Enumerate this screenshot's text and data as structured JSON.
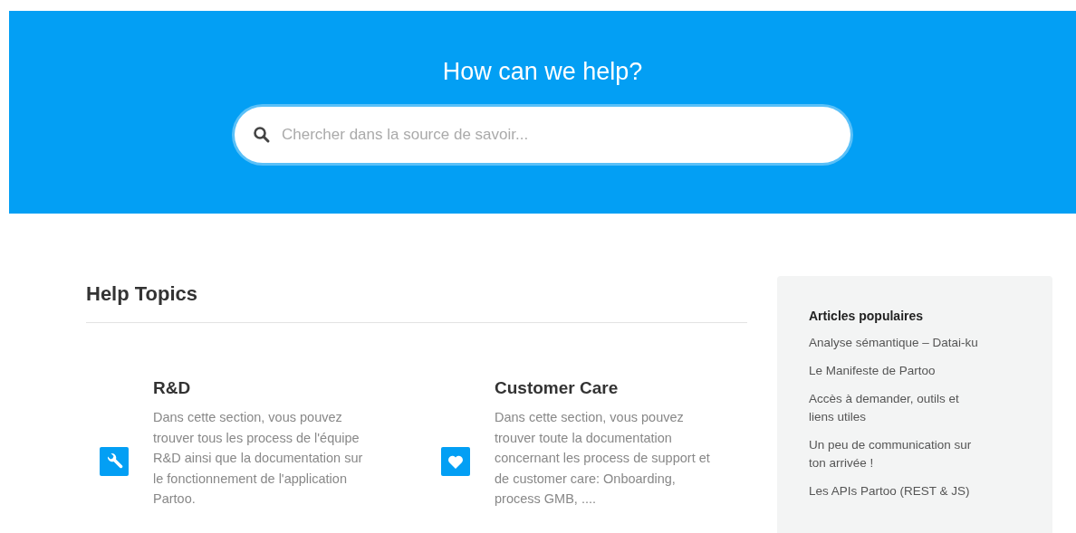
{
  "hero": {
    "title": "How can we help?",
    "search": {
      "placeholder": "Chercher dans la source de savoir..."
    }
  },
  "help_topics": {
    "title": "Help Topics",
    "topics": [
      {
        "kind": "wrench",
        "title": "R&D",
        "description": "Dans cette section, vous pouvez trouver tous les process de l'équipe R&D ainsi que la documentation sur le fonctionnement de l'application Partoo."
      },
      {
        "kind": "heart",
        "title": "Customer Care",
        "description": "Dans cette section, vous pouvez trouver toute la documentation concernant les process de support et de customer care: Onboarding, process GMB, ...."
      }
    ]
  },
  "popular_articles": {
    "title": "Articles populaires",
    "items": [
      "Analyse sémantique – Datai-ku",
      "Le Manifeste de Partoo",
      "Accès à demander, outils et liens utiles",
      "Un peu de communication sur ton arrivée !",
      "Les APIs Partoo (REST & JS)"
    ]
  }
}
